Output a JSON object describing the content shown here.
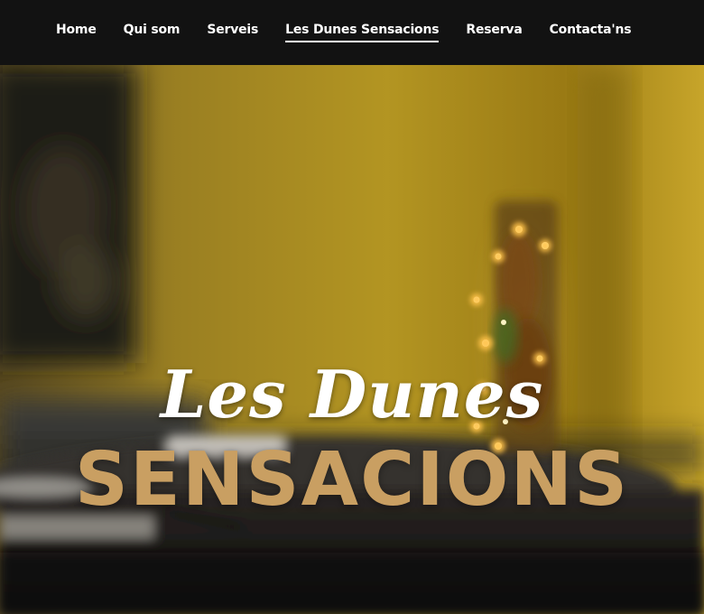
{
  "nav": {
    "items": [
      {
        "label": "Home"
      },
      {
        "label": "Qui som"
      },
      {
        "label": "Serveis"
      },
      {
        "label": "Les Dunes Sensacions",
        "active": true
      },
      {
        "label": "Reserva"
      },
      {
        "label": "Contacta'ns"
      }
    ]
  },
  "hero": {
    "script_title": "Les Dunes",
    "block_title": "SENSACIONS"
  },
  "colors": {
    "nav_background": "#121212",
    "nav_text": "#ffffff",
    "title_gold": "#c99f62",
    "wall_yellow": "#a38420",
    "table_dark": "#2c2a27"
  }
}
